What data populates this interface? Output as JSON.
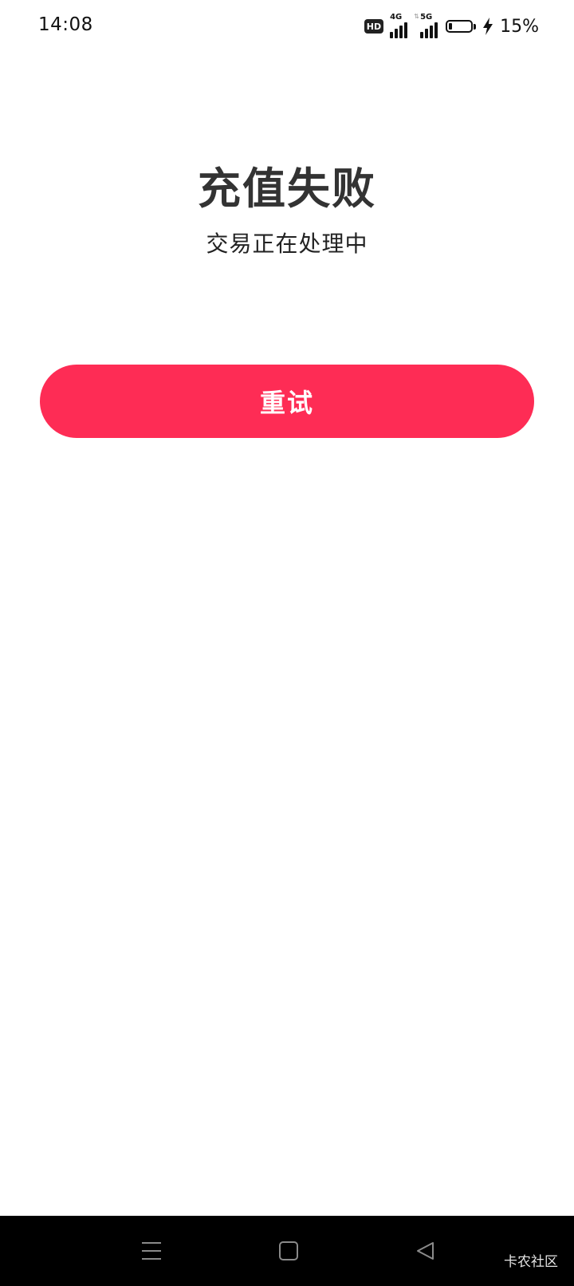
{
  "status_bar": {
    "time": "14:08",
    "hd_label": "HD",
    "network_1": "4G",
    "network_2": "5G",
    "battery_percent_text": "15%",
    "battery_level": 0.15
  },
  "main": {
    "title": "充值失败",
    "subtitle": "交易正在处理中",
    "retry_label": "重试"
  },
  "nav_bar": {
    "icons": [
      "menu-icon",
      "home-icon",
      "back-icon"
    ]
  },
  "watermark": {
    "text": "卡农社区"
  },
  "colors": {
    "accent": "#fe2c55",
    "title_text": "#333333",
    "nav_background": "#000000"
  }
}
